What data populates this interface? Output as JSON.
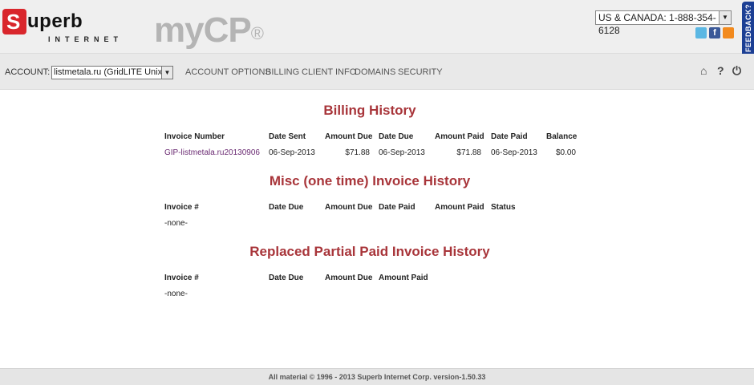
{
  "brand": {
    "logo_letter": "S",
    "logo_word": "uperb",
    "logo_sub": "INTERNET",
    "product": "myCP",
    "registered": "®"
  },
  "header": {
    "phone_select": "US & CANADA: 1-888-354-6128",
    "feedback_label": "FEEDBACK?",
    "social": [
      "twitter-icon",
      "facebook-icon",
      "rss-icon"
    ]
  },
  "nav": {
    "account_label": "ACCOUNT:",
    "account_value": "listmetala.ru (GridLITE Unix)",
    "items": [
      "ACCOUNT OPTIONS",
      "BILLING",
      "CLIENT INFO",
      "DOMAINS",
      "SECURITY"
    ],
    "icons": [
      "home-icon",
      "help-icon",
      "power-icon"
    ]
  },
  "billing": {
    "title": "Billing History",
    "headers": [
      "Invoice Number",
      "Date Sent",
      "Amount Due",
      "Date Due",
      "Amount Paid",
      "Date Paid",
      "Balance"
    ],
    "rows": [
      {
        "invoice": "GIP-listmetala.ru20130906",
        "date_sent": "06-Sep-2013",
        "amount_due": "$71.88",
        "date_due": "06-Sep-2013",
        "amount_paid": "$71.88",
        "date_paid": "06-Sep-2013",
        "balance": "$0.00"
      }
    ]
  },
  "misc": {
    "title": "Misc (one time) Invoice History",
    "headers": [
      "Invoice #",
      "Date Due",
      "Amount Due",
      "Date Paid",
      "Amount Paid",
      "Status"
    ],
    "empty": "-none-"
  },
  "replaced": {
    "title": "Replaced Partial Paid Invoice History",
    "headers": [
      "Invoice #",
      "Date Due",
      "Amount Due",
      "Amount Paid"
    ],
    "empty": "-none-"
  },
  "footer": {
    "text": "All material © 1996 - 2013 Superb Internet Corp. version-1.50.33"
  },
  "colors": {
    "title_red": "#a8353a",
    "link_purple": "#6a2a72",
    "logo_red": "#d9262c",
    "feedback_blue": "#1c3f94"
  }
}
